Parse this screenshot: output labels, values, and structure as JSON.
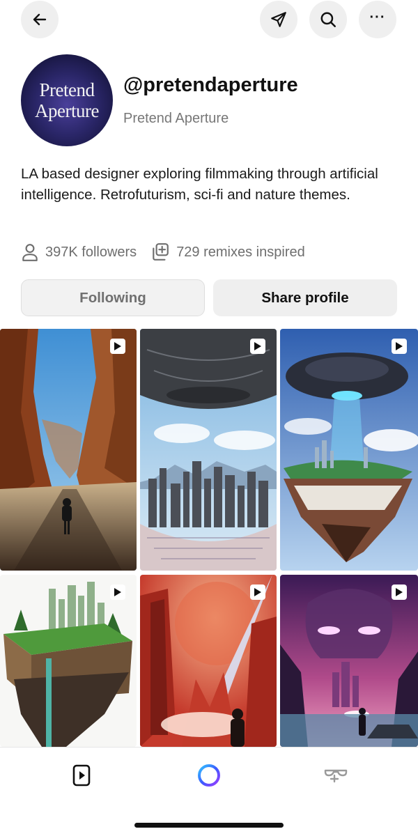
{
  "header": {
    "back_icon": "arrow-left-icon",
    "actions": [
      "send-icon",
      "search-icon",
      "more-icon"
    ],
    "more_label": "···"
  },
  "profile": {
    "avatar_text_line1": "Pretend",
    "avatar_text_line2": "Aperture",
    "handle": "@pretendaperture",
    "display_name": "Pretend Aperture",
    "bio": "LA based designer exploring filmmaking through artificial intelligence. Retrofuturism, sci-fi and nature themes.",
    "followers": "397K followers",
    "remixes": "729 remixes inspired"
  },
  "buttons": {
    "following": "Following",
    "share": "Share profile"
  },
  "grid": {
    "items": [
      {
        "type": "video",
        "subject": "canyon-cyclist"
      },
      {
        "type": "video",
        "subject": "inverted-city"
      },
      {
        "type": "video",
        "subject": "ufo-floating-island"
      },
      {
        "type": "video",
        "subject": "floating-city-block"
      },
      {
        "type": "video",
        "subject": "red-canyon-beam"
      },
      {
        "type": "video",
        "subject": "giant-face-sky"
      }
    ]
  },
  "bottom_nav": {
    "items": [
      "video-feed-icon",
      "create-ring-icon",
      "remix-icon"
    ]
  },
  "colors": {
    "secondary_text": "#777777",
    "button_bg": "#efefef",
    "create_ring_gradient": [
      "#3b5bff",
      "#9b3bff",
      "#33c8ff"
    ]
  }
}
